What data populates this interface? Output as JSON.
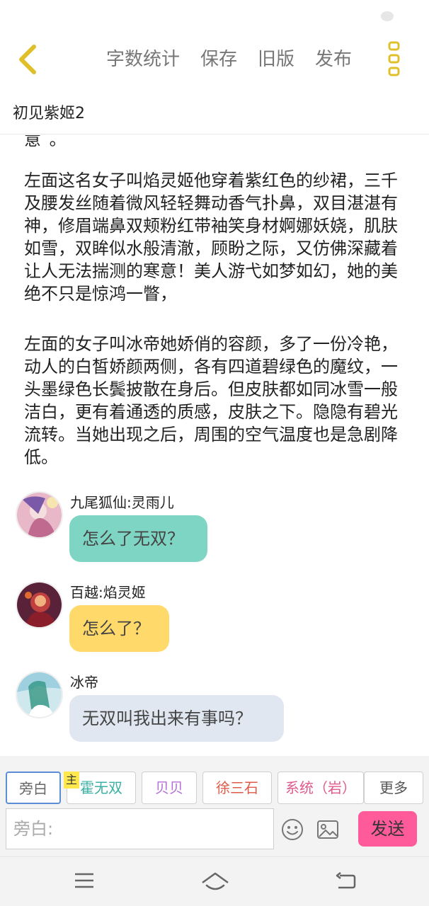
{
  "header": {
    "toolbar": [
      "字数统计",
      "保存",
      "旧版",
      "发布"
    ],
    "doc_title": "初见紫姬2"
  },
  "content": {
    "cut_text": "意 。",
    "paragraphs": [
      "左面这名女子叫焰灵姬他穿着紫红色的纱裙，三千及腰发丝随着微风轻轻舞动香气扑鼻，双目湛湛有神，修眉端鼻双颊粉红带袖笑身材婀娜妖娆，肌肤如雪，双眸似水般清澈，顾盼之际，又仿佛深藏着让人无法揣测的寒意！美人游弋如梦如幻，她的美绝不只是惊鸿一瞥，",
      "左面的女子叫冰帝她娇俏的容颜，多了一份冷艳，动人的白皙娇颜两侧，各有四道碧绿色的魔纹，一头墨绿色长鬓披散在身后。但皮肤都如同冰雪一般洁白，更有着通透的质感，皮肤之下。隐隐有碧光流转。当她出现之后，周围的空气温度也是急剧降低。"
    ],
    "messages": [
      {
        "speaker": "九尾狐仙:灵雨儿",
        "text": "怎么了无双？",
        "color": "#7fd5c4"
      },
      {
        "speaker": "百越:焰灵姬",
        "text": "怎么了？",
        "color": "#ffd96a"
      },
      {
        "speaker": "冰帝",
        "text": "无双叫我出来有事吗？",
        "color": "#e1e7f0"
      }
    ]
  },
  "roles": {
    "chips": [
      "旁白",
      "霍无双",
      "贝贝",
      "徐三石",
      "系统（岩）",
      "更多"
    ],
    "main_tag": "主"
  },
  "input": {
    "placeholder": "旁白:",
    "send_label": "发送"
  },
  "colors": {
    "accent": "#ff5b9a",
    "icon_yellow": "#e0c02a"
  }
}
